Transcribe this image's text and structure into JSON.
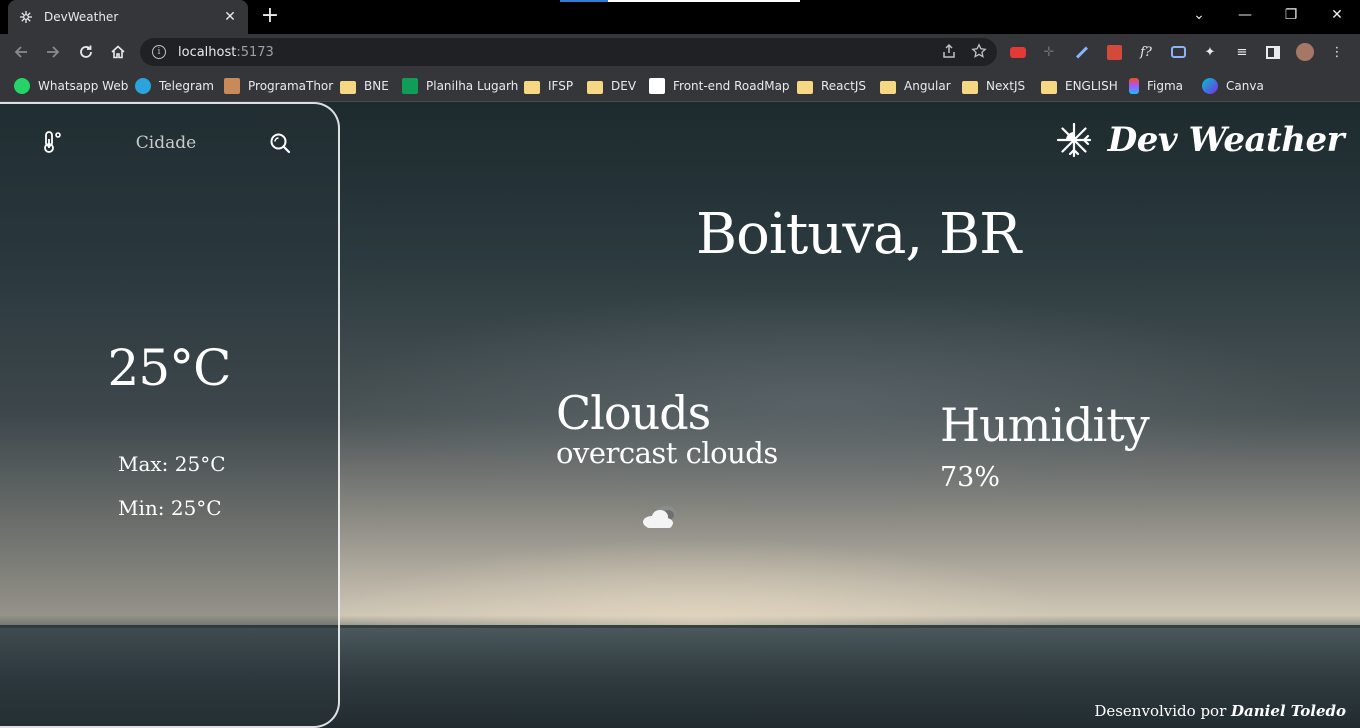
{
  "browser": {
    "tab": {
      "title": "DevWeather",
      "icon": "sun-snowflake-icon"
    },
    "address": {
      "host": "localhost",
      "port": ":5173"
    },
    "bookmarks": [
      {
        "label": "Whatsapp Web",
        "icon": "whatsapp-icon"
      },
      {
        "label": "Telegram",
        "icon": "telegram-icon"
      },
      {
        "label": "ProgramaThor",
        "icon": "hammer-icon"
      },
      {
        "label": "BNE",
        "icon": "folder-icon"
      },
      {
        "label": "Planilha Lugarh",
        "icon": "sheets-icon"
      },
      {
        "label": "IFSP",
        "icon": "folder-icon"
      },
      {
        "label": "DEV",
        "icon": "folder-icon"
      },
      {
        "label": "Front-end RoadMap",
        "icon": "roadmap-icon"
      },
      {
        "label": "ReactJS",
        "icon": "folder-icon"
      },
      {
        "label": "Angular",
        "icon": "folder-icon"
      },
      {
        "label": "NextJS",
        "icon": "folder-icon"
      },
      {
        "label": "ENGLISH",
        "icon": "folder-icon"
      },
      {
        "label": "Figma",
        "icon": "figma-icon"
      },
      {
        "label": "Canva",
        "icon": "canva-icon"
      }
    ]
  },
  "app": {
    "brand": "Dev Weather",
    "search": {
      "placeholder": "Cidade"
    },
    "temperature": "25°C",
    "max": "Max: 25°C",
    "min": "Min: 25°C",
    "location": "Boituva, BR",
    "condition": "Clouds",
    "description": "overcast clouds",
    "humidity_label": "Humidity",
    "humidity_value": "73%",
    "footer_prefix": "Desenvolvido por ",
    "footer_author": "Daniel Toledo"
  }
}
